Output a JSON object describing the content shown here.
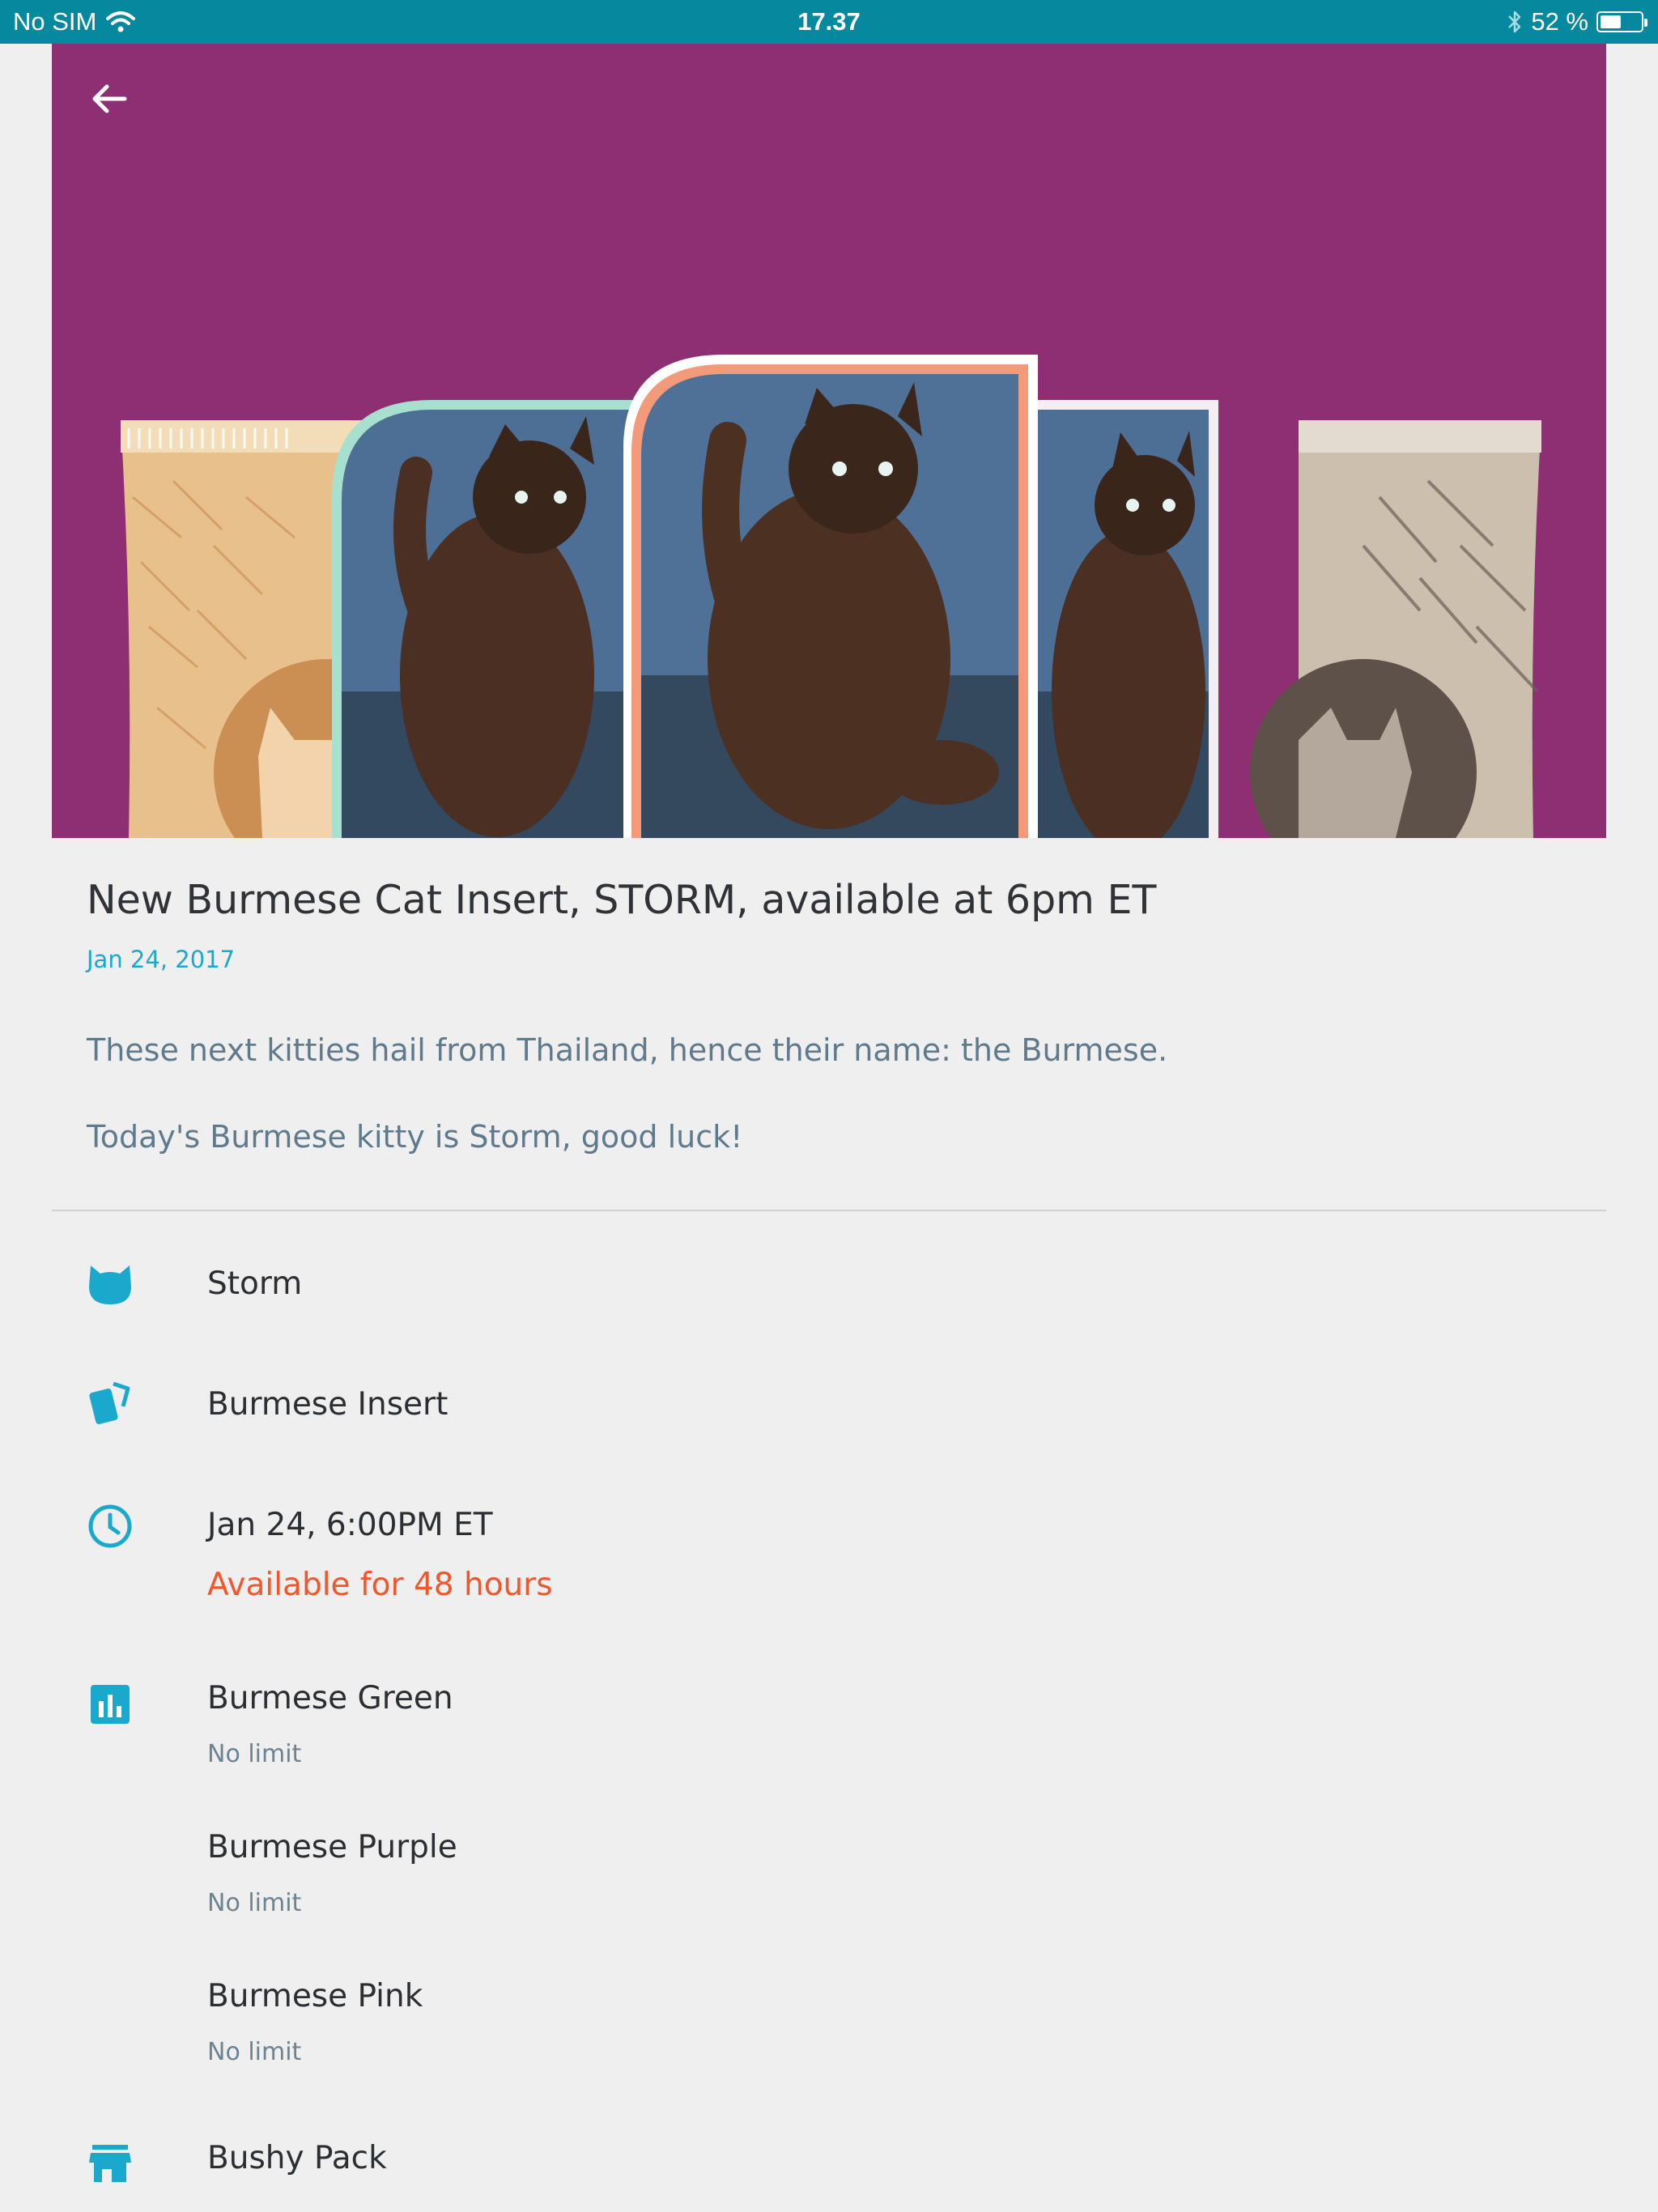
{
  "status_bar": {
    "carrier": "No SIM",
    "time": "17.37",
    "battery_text": "52 %",
    "battery_level": 0.52
  },
  "hero": {
    "background_color": "#8e2f74",
    "back_icon": "arrow-left-icon"
  },
  "post": {
    "title": "New Burmese Cat Insert, STORM, available at 6pm ET",
    "date": "Jan 24, 2017",
    "paragraphs": [
      "These next kitties hail from Thailand, hence their name: the Burmese.",
      "Today's Burmese kitty is Storm, good luck!"
    ]
  },
  "details": {
    "cat": {
      "icon": "cat-face-icon",
      "label": "Storm"
    },
    "card": {
      "icon": "cards-icon",
      "label": "Burmese Insert"
    },
    "time": {
      "icon": "clock-icon",
      "label": "Jan 24, 6:00PM ET",
      "availability": "Available for 48 hours"
    },
    "variants": {
      "icon": "bar-chart-icon",
      "items": [
        {
          "name": "Burmese Green",
          "limit": "No limit"
        },
        {
          "name": "Burmese Purple",
          "limit": "No limit"
        },
        {
          "name": "Burmese Pink",
          "limit": "No limit"
        }
      ]
    },
    "pack": {
      "icon": "store-icon",
      "label": "Bushy Pack"
    }
  },
  "colors": {
    "accent": "#1aa9cd",
    "warning": "#f2572b",
    "status_bar": "#06889e"
  }
}
